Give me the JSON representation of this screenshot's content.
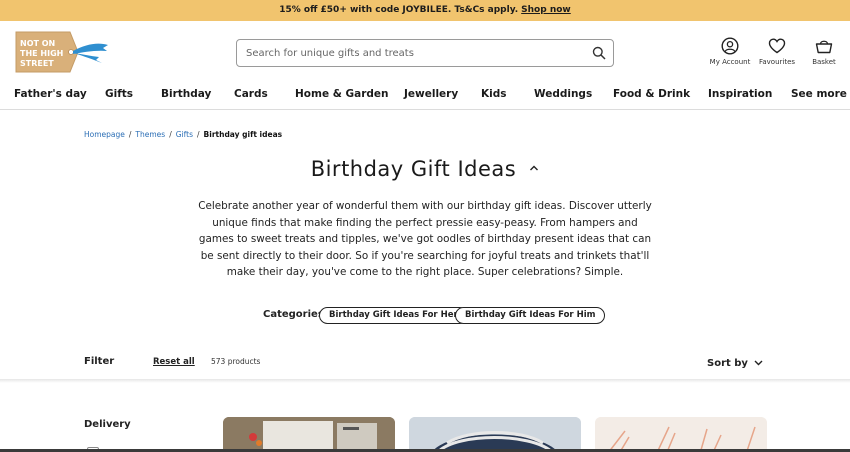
{
  "promo": {
    "text": "15% off £50+ with code JOYBILEE. Ts&Cs apply.",
    "link": "Shop now"
  },
  "logo": {
    "lines": [
      "NOT ON",
      "THE HIGH",
      "STREET"
    ]
  },
  "search": {
    "placeholder": "Search for unique gifts and treats"
  },
  "header": {
    "account": "My Account",
    "favourites": "Favourites",
    "basket": "Basket"
  },
  "nav": [
    "Father's day",
    "Gifts",
    "Birthday",
    "Cards",
    "Home & Garden",
    "Jewellery",
    "Kids",
    "Weddings",
    "Food & Drink",
    "Inspiration",
    "See more"
  ],
  "breadcrumb": {
    "items": [
      "Homepage",
      "Themes",
      "Gifts"
    ],
    "current": "Birthday gift ideas"
  },
  "page": {
    "title": "Birthday Gift Ideas",
    "description": "Celebrate another year of wonderful them with our birthday gift ideas. Discover utterly unique finds that make finding the perfect pressie easy-peasy. From hampers and games to sweet treats and tipples, we've got oodles of birthday present ideas that can be sent directly to their door. So if you're searching for joyful treats and trinkets that'll make their day, you've come to the right place. Super celebrations? Simple."
  },
  "categories": {
    "label": "Categories",
    "items": [
      "Birthday Gift Ideas For Her",
      "Birthday Gift Ideas For Him"
    ]
  },
  "filter": {
    "label": "Filter",
    "reset": "Reset all",
    "count": "573 products",
    "sort": "Sort by"
  },
  "sidebar": {
    "delivery": "Delivery"
  },
  "colors": {
    "promo_bg": "#f1c46e",
    "link": "#2c6fb6",
    "logo_tag": "#d9b07a",
    "logo_ribbon": "#2f8fd0"
  }
}
